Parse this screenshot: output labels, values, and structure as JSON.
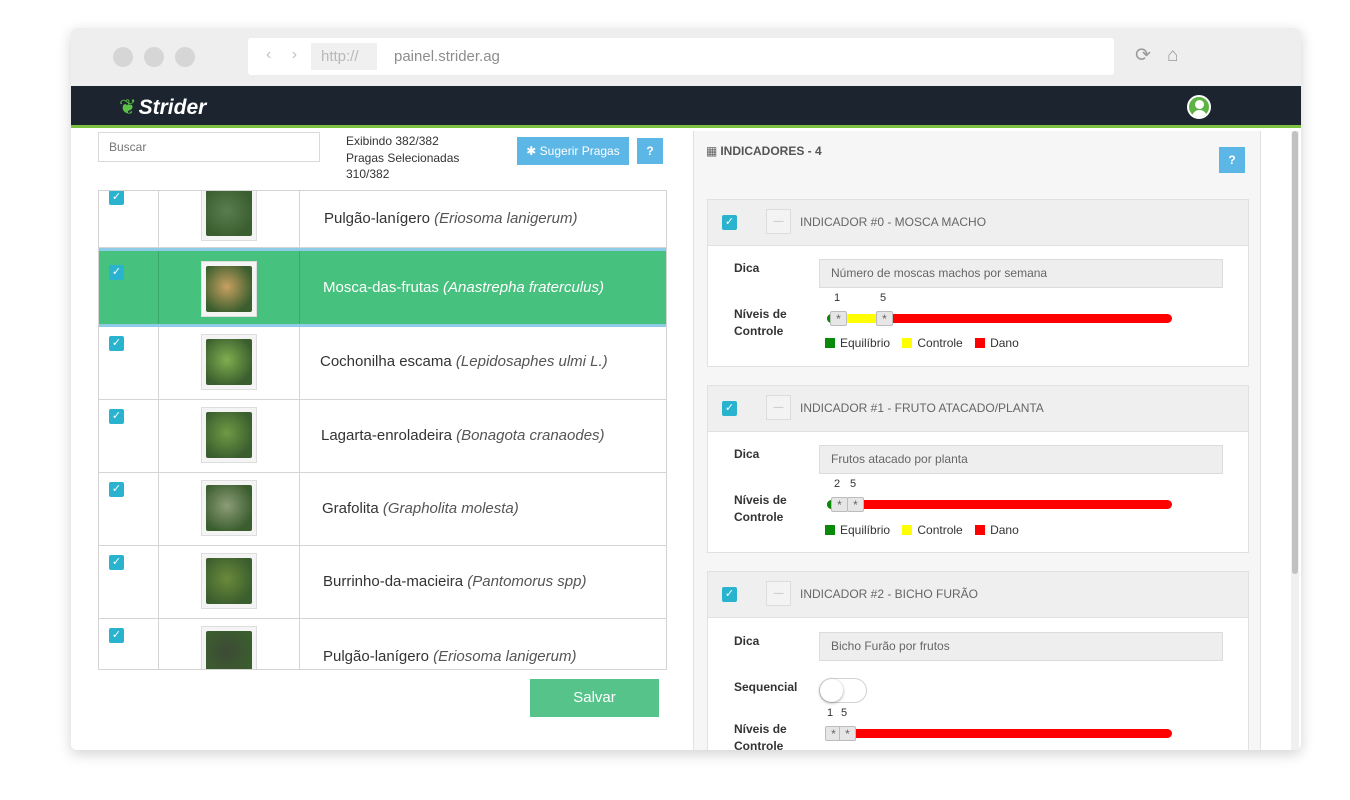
{
  "browser": {
    "nav_arrows": "‹ ›",
    "protocol": "http://",
    "url": "painel.strider.ag"
  },
  "app": {
    "logo": "Strider"
  },
  "left": {
    "search_placeholder": "Buscar",
    "showing_line1": "Exibindo 382/382",
    "showing_line2": "Pragas Selecionadas",
    "showing_line3": "310/382",
    "suggest_button": "Sugerir Pragas",
    "help_button": "?",
    "save_button": "Salvar",
    "pests": [
      {
        "common": "Pulgão-lanígero",
        "scientific": "(Eriosoma lanigerum)",
        "selected": false,
        "checked": true,
        "thumb_color": "#5a7d4f"
      },
      {
        "common": "Mosca-das-frutas",
        "scientific": "(Anastrepha fraterculus)",
        "selected": true,
        "checked": true,
        "thumb_color": "#c8a060"
      },
      {
        "common": "Cochonilha escama",
        "scientific": "(Lepidosaphes ulmi L.)",
        "selected": false,
        "checked": true,
        "thumb_color": "#7fae4e"
      },
      {
        "common": "Lagarta-enroladeira",
        "scientific": "(Bonagota cranaodes)",
        "selected": false,
        "checked": true,
        "thumb_color": "#6f9a45"
      },
      {
        "common": "Grafolita",
        "scientific": "(Grapholita molesta)",
        "selected": false,
        "checked": true,
        "thumb_color": "#8c9c78"
      },
      {
        "common": "Burrinho-da-macieira",
        "scientific": "(Pantomorus spp)",
        "selected": false,
        "checked": true,
        "thumb_color": "#6a8a3a"
      },
      {
        "common": "Pulgão-lanígero",
        "scientific": "(Eriosoma lanigerum)",
        "selected": false,
        "checked": true,
        "thumb_color": "#3d4a36"
      }
    ]
  },
  "right": {
    "header": "INDICADORES - 4",
    "help_button": "?",
    "hint_label": "Dica",
    "levels_label_1": "Níveis de",
    "levels_label_2": "Controle",
    "sequential_label": "Sequencial",
    "legend": [
      "Equilíbrio",
      "Controle",
      "Dano"
    ],
    "colors": {
      "equilibrio": "#0a8a0a",
      "controle": "#ffff00",
      "dano": "#ff0000"
    },
    "indicators": [
      {
        "title": "INDICADOR #0 - MOSCA MACHO",
        "hint": "Número de  moscas machos por semana",
        "min": "1",
        "max": "5",
        "checked": true
      },
      {
        "title": "INDICADOR #1 - FRUTO ATACADO/PLANTA",
        "hint": "Frutos atacado por planta",
        "min": "2",
        "max": "5",
        "checked": true
      },
      {
        "title": "INDICADOR #2 - BICHO FURÃO",
        "hint": "Bicho Furão por frutos",
        "min": "1",
        "max": "5",
        "checked": true,
        "sequential": false
      }
    ]
  }
}
